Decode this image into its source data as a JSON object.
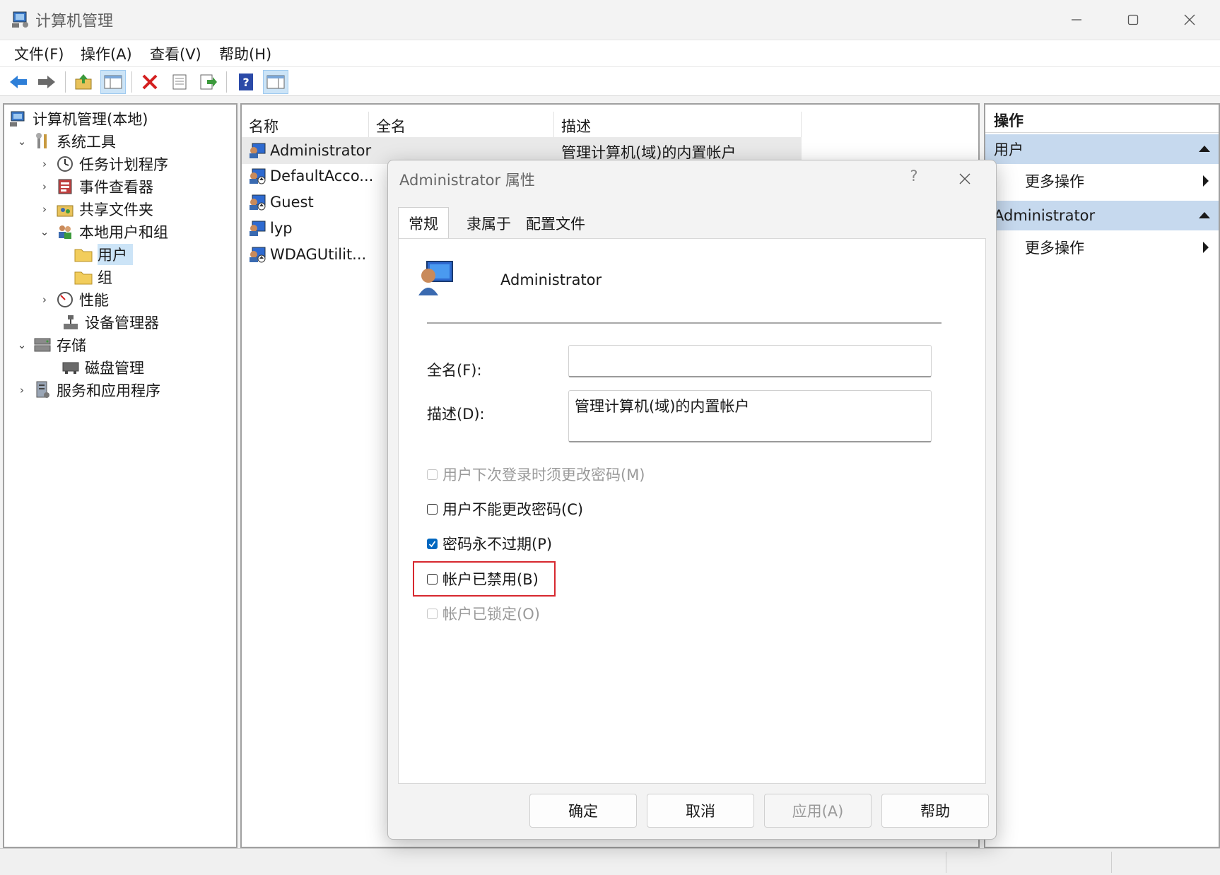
{
  "window": {
    "title": "计算机管理"
  },
  "menu": [
    "文件(F)",
    "操作(A)",
    "查看(V)",
    "帮助(H)"
  ],
  "tree": {
    "root": "计算机管理(本地)",
    "items": [
      {
        "label": "系统工具"
      },
      {
        "label": "任务计划程序"
      },
      {
        "label": "事件查看器"
      },
      {
        "label": "共享文件夹"
      },
      {
        "label": "本地用户和组"
      },
      {
        "label": "用户"
      },
      {
        "label": "组"
      },
      {
        "label": "性能"
      },
      {
        "label": "设备管理器"
      },
      {
        "label": "存储"
      },
      {
        "label": "磁盘管理"
      },
      {
        "label": "服务和应用程序"
      }
    ]
  },
  "list": {
    "columns": [
      "名称",
      "全名",
      "描述"
    ],
    "rows": [
      {
        "name": "Administrator",
        "description": "管理计算机(域)的内置帐户"
      },
      {
        "name": "DefaultAcco..."
      },
      {
        "name": "Guest"
      },
      {
        "name": "lyp"
      },
      {
        "name": "WDAGUtilit..."
      }
    ]
  },
  "actions": {
    "header": "操作",
    "groups": [
      {
        "label": "用户",
        "sub": "更多操作"
      },
      {
        "label": "Administrator",
        "sub": "更多操作"
      }
    ]
  },
  "dialog": {
    "title": "Administrator 属性",
    "help_glyph": "?",
    "tabs": [
      "常规",
      "隶属于",
      "配置文件"
    ],
    "user_name": "Administrator",
    "fullname_label": "全名(F):",
    "fullname_value": "",
    "description_label": "描述(D):",
    "description_value": "管理计算机(域)的内置帐户",
    "checkboxes": [
      {
        "label": "用户下次登录时须更改密码(M)",
        "checked": false,
        "disabled": true
      },
      {
        "label": "用户不能更改密码(C)",
        "checked": false,
        "disabled": false
      },
      {
        "label": "密码永不过期(P)",
        "checked": true,
        "disabled": false
      },
      {
        "label": "帐户已禁用(B)",
        "checked": false,
        "disabled": false
      },
      {
        "label": "帐户已锁定(O)",
        "checked": false,
        "disabled": true
      }
    ],
    "buttons": {
      "ok": "确定",
      "cancel": "取消",
      "apply": "应用(A)",
      "help": "帮助"
    }
  },
  "colors": {
    "accent": "#0067c0",
    "selection": "#cce4f7",
    "action_group": "#c6d9ee",
    "highlight": "#d7282f"
  }
}
